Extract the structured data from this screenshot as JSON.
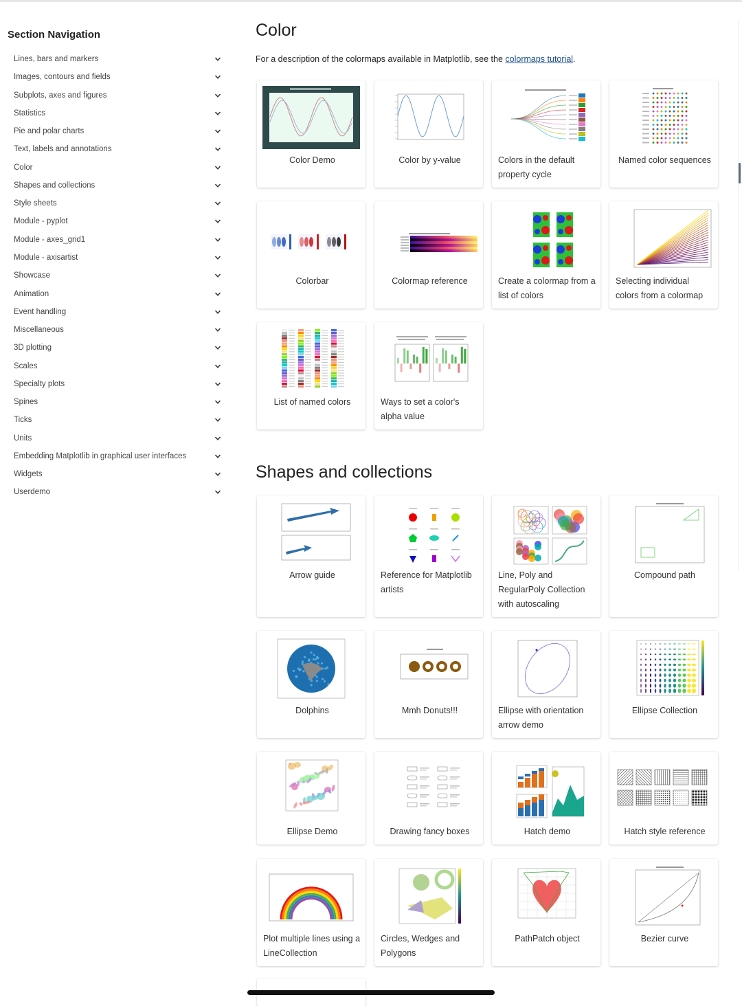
{
  "sidebar": {
    "title": "Section Navigation",
    "items": [
      "Lines, bars and markers",
      "Images, contours and fields",
      "Subplots, axes and figures",
      "Statistics",
      "Pie and polar charts",
      "Text, labels and annotations",
      "Color",
      "Shapes and collections",
      "Style sheets",
      "Module - pyplot",
      "Module - axes_grid1",
      "Module - axisartist",
      "Showcase",
      "Animation",
      "Event handling",
      "Miscellaneous",
      "3D plotting",
      "Scales",
      "Specialty plots",
      "Spines",
      "Ticks",
      "Units",
      "Embedding Matplotlib in graphical user interfaces",
      "Widgets",
      "Userdemo"
    ]
  },
  "color_section": {
    "title": "Color",
    "description_prefix": "For a description of the colormaps available in Matplotlib, see the ",
    "link_text": "colormaps tutorial",
    "description_suffix": ".",
    "cards": [
      {
        "caption": "Color Demo",
        "icon": "color-demo-thumbnail"
      },
      {
        "caption": "Color by y-value",
        "icon": "color-by-y-value-thumbnail"
      },
      {
        "caption": "Colors in the default property cycle",
        "icon": "property-cycle-thumbnail"
      },
      {
        "caption": "Named color sequences",
        "icon": "named-sequences-thumbnail"
      },
      {
        "caption": "Colorbar",
        "icon": "colorbar-thumbnail"
      },
      {
        "caption": "Colormap reference",
        "icon": "colormap-reference-thumbnail"
      },
      {
        "caption": "Create a colormap from a list of colors",
        "icon": "colormap-from-list-thumbnail"
      },
      {
        "caption": "Selecting individual colors from a colormap",
        "icon": "individual-colors-thumbnail"
      },
      {
        "caption": "List of named colors",
        "icon": "named-colors-thumbnail"
      },
      {
        "caption": "Ways to set a color's alpha value",
        "icon": "alpha-value-thumbnail"
      }
    ]
  },
  "shapes_section": {
    "title": "Shapes and collections",
    "cards": [
      {
        "caption": "Arrow guide",
        "icon": "arrow-guide-thumbnail"
      },
      {
        "caption": "Reference for Matplotlib artists",
        "icon": "artists-reference-thumbnail"
      },
      {
        "caption": "Line, Poly and RegularPoly Collection with autoscaling",
        "icon": "collections-thumbnail"
      },
      {
        "caption": "Compound path",
        "icon": "compound-path-thumbnail"
      },
      {
        "caption": "Dolphins",
        "icon": "dolphins-thumbnail"
      },
      {
        "caption": "Mmh Donuts!!!",
        "icon": "donuts-thumbnail"
      },
      {
        "caption": "Ellipse with orientation arrow demo",
        "icon": "ellipse-arrow-thumbnail"
      },
      {
        "caption": "Ellipse Collection",
        "icon": "ellipse-collection-thumbnail"
      },
      {
        "caption": "Ellipse Demo",
        "icon": "ellipse-demo-thumbnail"
      },
      {
        "caption": "Drawing fancy boxes",
        "icon": "fancy-boxes-thumbnail"
      },
      {
        "caption": "Hatch demo",
        "icon": "hatch-demo-thumbnail"
      },
      {
        "caption": "Hatch style reference",
        "icon": "hatch-reference-thumbnail"
      },
      {
        "caption": "Plot multiple lines using a LineCollection",
        "icon": "line-collection-thumbnail"
      },
      {
        "caption": "Circles, Wedges and Polygons",
        "icon": "circles-wedges-thumbnail"
      },
      {
        "caption": "PathPatch object",
        "icon": "pathpatch-thumbnail"
      },
      {
        "caption": "Bezier curve",
        "icon": "bezier-curve-thumbnail"
      }
    ]
  }
}
